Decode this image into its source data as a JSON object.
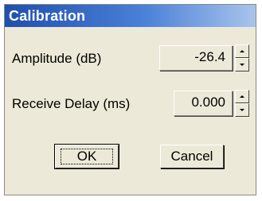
{
  "window": {
    "title": "Calibration"
  },
  "fields": {
    "amplitude": {
      "label": "Amplitude (dB)",
      "value": "-26.4"
    },
    "receive_delay": {
      "label": "Receive Delay (ms)",
      "value": "0.000"
    }
  },
  "buttons": {
    "ok_label": "OK",
    "cancel_label": "Cancel"
  },
  "icons": {
    "spin_up": "arrow-up-icon",
    "spin_down": "arrow-down-icon"
  },
  "colors": {
    "titlebar_start": "#1f4fae",
    "titlebar_end": "#a9c4ec",
    "dialog_bg": "#ece9d8"
  }
}
